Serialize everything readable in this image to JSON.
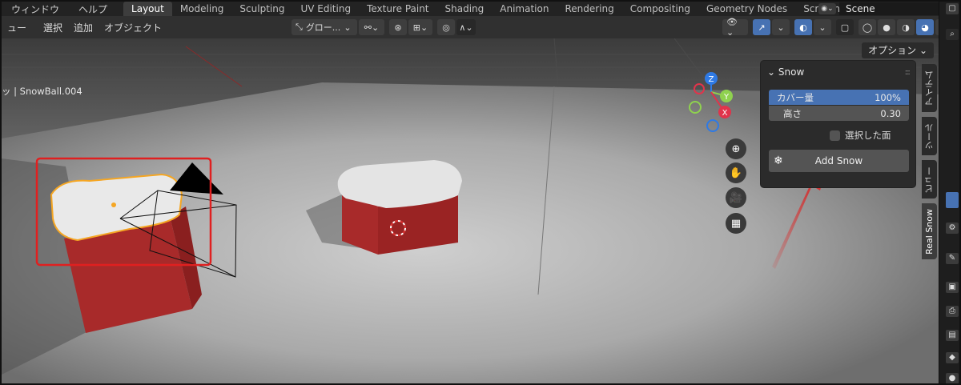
{
  "topbar": {
    "menus": [
      "ウィンドウ",
      "ヘルプ"
    ],
    "workspaces": [
      {
        "label": "Layout",
        "active": true
      },
      {
        "label": "Modeling"
      },
      {
        "label": "Sculpting"
      },
      {
        "label": "UV Editing"
      },
      {
        "label": "Texture Paint"
      },
      {
        "label": "Shading"
      },
      {
        "label": "Animation"
      },
      {
        "label": "Rendering"
      },
      {
        "label": "Compositing"
      },
      {
        "label": "Geometry Nodes"
      },
      {
        "label": "Scripting"
      }
    ],
    "add_workspace": "+",
    "scene_name": "Scene"
  },
  "header": {
    "menus": [
      "ュー",
      "選択",
      "追加",
      "オブジェクト"
    ],
    "orientation": "グロー...",
    "options_label": "オプション"
  },
  "viewport": {
    "object_label": "ッ | SnowBall.004",
    "gizmo": {
      "z": "Z",
      "y": "Y",
      "x": "X"
    }
  },
  "panel": {
    "title": "Snow",
    "coverage_label": "カバー量",
    "coverage_value": "100%",
    "height_label": "高さ",
    "height_value": "0.30",
    "selected_faces_label": "選択した面",
    "add_snow_label": "Add Snow"
  },
  "side_tabs": [
    "アイテム",
    "ツール",
    "ビュー",
    "Real Snow"
  ],
  "colors": {
    "accent": "#4772b3",
    "cube_red": "#a82a2a",
    "selection_orange": "#f5a623",
    "annotation_red": "#e02020"
  }
}
